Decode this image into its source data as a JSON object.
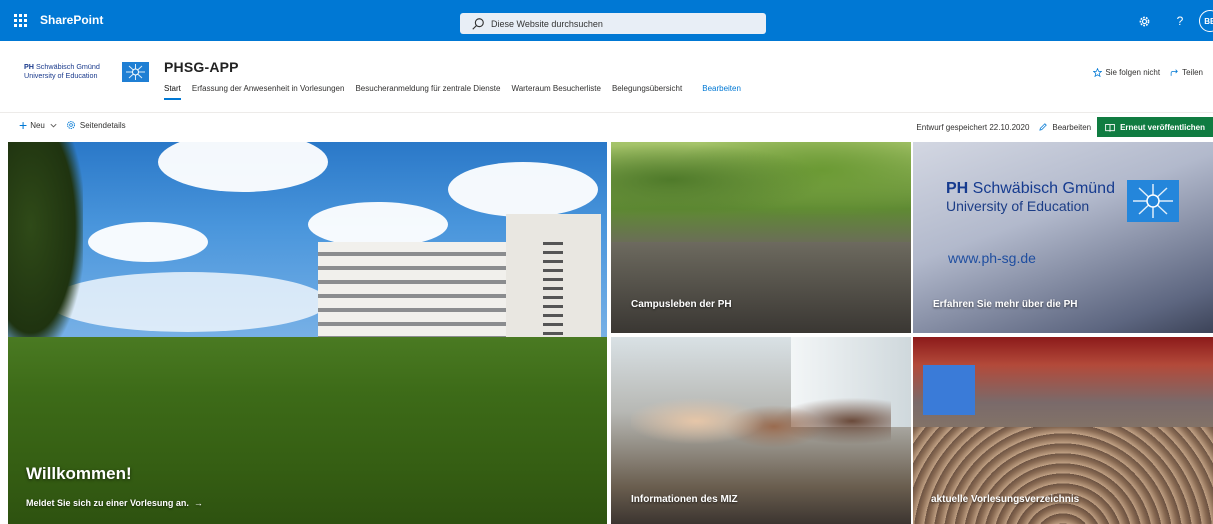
{
  "suite": {
    "app_name": "SharePoint",
    "search_placeholder": "Diese Website durchsuchen",
    "help_label": "?",
    "avatar_initials": "BB",
    "brand_color": "#0078d4"
  },
  "site": {
    "logo_line1_bold": "PH",
    "logo_line1_rest": " Schwäbisch Gmünd",
    "logo_line2": "University of Education",
    "title": "PHSG-APP",
    "nav": [
      {
        "label": "Start"
      },
      {
        "label": "Erfassung der Anwesenheit in Vorlesungen"
      },
      {
        "label": "Besucheranmeldung für zentrale Dienste"
      },
      {
        "label": "Warteraum Besucherliste"
      },
      {
        "label": "Belegungsübersicht"
      }
    ],
    "nav_edit": "Bearbeiten",
    "follow_label": "Sie folgen nicht",
    "share_label": "Teilen"
  },
  "command": {
    "new_label": "Neu",
    "page_details_label": "Seitendetails",
    "draft_status": "Entwurf gespeichert 22.10.2020",
    "edit_label": "Bearbeiten",
    "republish_label": "Erneut veröffentlichen",
    "republish_color": "#107c41"
  },
  "hero": {
    "main_title": "Willkommen!",
    "main_link": "Meldet Sie sich zu einer Vorlesung an.",
    "tiles": [
      {
        "label": "Campusleben der PH"
      },
      {
        "label": "Erfahren Sie mehr über die PH"
      },
      {
        "label": "Informationen des MIZ"
      },
      {
        "label": "aktuelle Vorlesungsverzeichnis"
      }
    ],
    "ph_tile_logo_bold": "PH",
    "ph_tile_logo_rest": " Schwäbisch Gmünd",
    "ph_tile_logo_line2": "University of Education",
    "ph_tile_url": "www.ph-sg.de"
  }
}
